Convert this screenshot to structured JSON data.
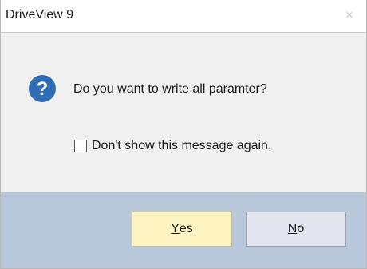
{
  "window": {
    "title": "DriveView 9",
    "close_glyph": "×"
  },
  "message": {
    "icon": "question-icon",
    "text": "Do you want to write all paramter?"
  },
  "checkbox": {
    "checked": false,
    "label": "Don't show this message again."
  },
  "buttons": {
    "yes_mnemonic": "Y",
    "yes_rest": "es",
    "no_mnemonic": "N",
    "no_rest": "o"
  },
  "colors": {
    "button_bar": "#b8c7d9",
    "yes_button": "#fdf3c0",
    "icon_blue": "#2e6db4"
  }
}
